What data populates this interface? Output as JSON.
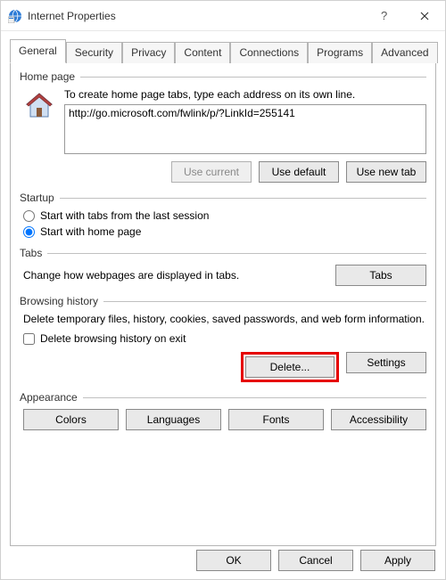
{
  "title": "Internet Properties",
  "tabs": {
    "general": "General",
    "security": "Security",
    "privacy": "Privacy",
    "content": "Content",
    "connections": "Connections",
    "programs": "Programs",
    "advanced": "Advanced"
  },
  "homepage": {
    "legend": "Home page",
    "hint": "To create home page tabs, type each address on its own line.",
    "value": "http://go.microsoft.com/fwlink/p/?LinkId=255141",
    "use_current": "Use current",
    "use_default": "Use default",
    "use_new_tab": "Use new tab"
  },
  "startup": {
    "legend": "Startup",
    "opt_tabs": "Start with tabs from the last session",
    "opt_home": "Start with home page"
  },
  "tabsGroup": {
    "legend": "Tabs",
    "desc": "Change how webpages are displayed in tabs.",
    "button": "Tabs"
  },
  "history": {
    "legend": "Browsing history",
    "desc": "Delete temporary files, history, cookies, saved passwords, and web form information.",
    "check": "Delete browsing history on exit",
    "delete": "Delete...",
    "settings": "Settings"
  },
  "appearance": {
    "legend": "Appearance",
    "colors": "Colors",
    "languages": "Languages",
    "fonts": "Fonts",
    "accessibility": "Accessibility"
  },
  "dialog": {
    "ok": "OK",
    "cancel": "Cancel",
    "apply": "Apply"
  }
}
